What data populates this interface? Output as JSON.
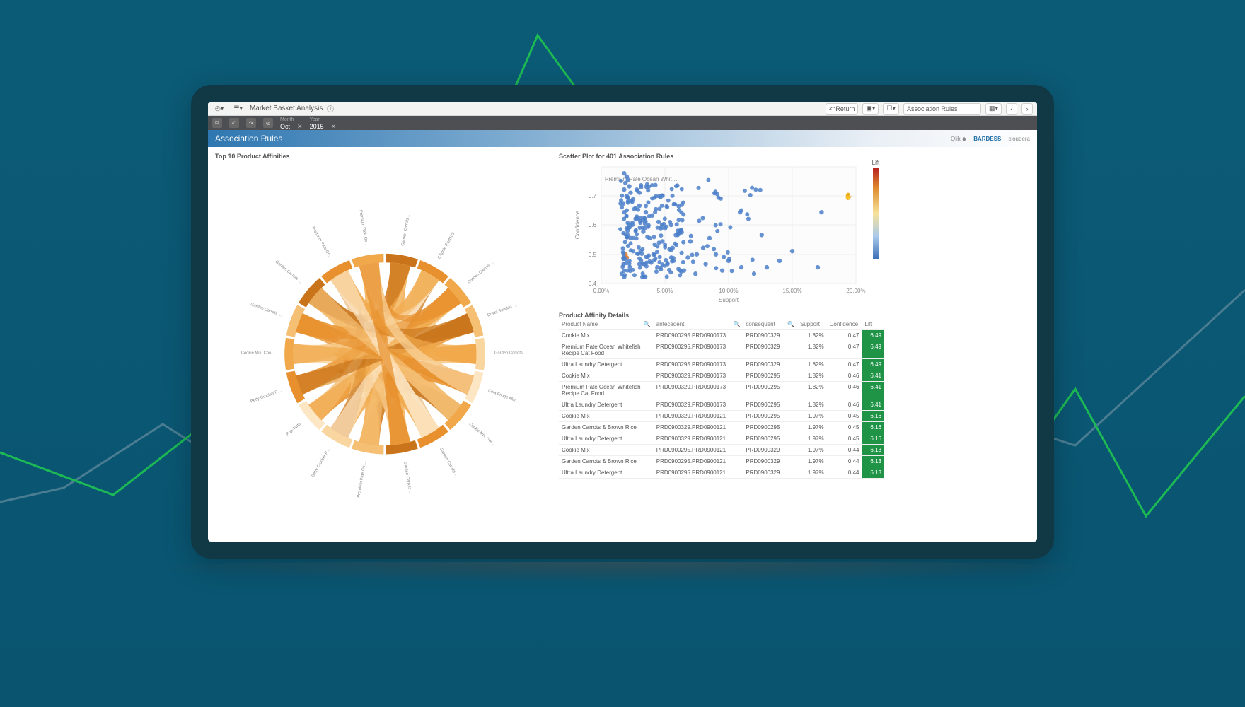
{
  "appbar": {
    "title": "Market Basket Analysis",
    "return": "Return",
    "sheets": "Association Rules"
  },
  "ribbon": {
    "month_label": "Month",
    "month_val": "Oct",
    "year_label": "Year",
    "year_val": "2015"
  },
  "sheet": {
    "title": "Association Rules",
    "brand_qlik": "Qlik",
    "brand_bardess": "BARDESS",
    "brand_cloudera": "cloudera"
  },
  "scatter": {
    "title": "Scatter Plot for 401 Association Rules",
    "xlabel": "Support",
    "ylabel": "Confidence",
    "lift_label": "Lift",
    "annotation": "Premium Pate Ocean Whit…"
  },
  "chord": {
    "title": "Top 10 Product Affinities",
    "labels": [
      "Garden Carrots …",
      "6 Apple Fruit103",
      "Garden Carrots …",
      "Duvet Bonded …",
      "Garden Carrots …",
      "Cola Fridge Mat…",
      "Cookie Mix, Gar…",
      "Garden Carrots …",
      "Garden Carrots …",
      "Premium Pate Oc…",
      "Betty Crocker P…",
      "Pop-Tarts",
      "Betty Crocker P…",
      "Cookie Mix, Coo…",
      "Garden Carrots …",
      "Garden Carrots …",
      "Premium Pate Oc…",
      "Premium Pate Oc…"
    ]
  },
  "table": {
    "title": "Product Affinity Details",
    "cols": [
      "Product Name",
      "antecedent",
      "consequent",
      "Support",
      "Confidence",
      "Lift"
    ],
    "rows": [
      {
        "p": "Cookie Mix",
        "a": "PRD0900295.PRD0900173",
        "c": "PRD0900329",
        "s": "1.82%",
        "con": "0.47",
        "l": "6.49"
      },
      {
        "p": "Premium Pate Ocean Whitefish Recipe Cat Food",
        "a": "PRD0900295.PRD0900173",
        "c": "PRD0900329",
        "s": "1.82%",
        "con": "0.47",
        "l": "6.49"
      },
      {
        "p": "Ultra Laundry Detergent",
        "a": "PRD0900295.PRD0900173",
        "c": "PRD0900329",
        "s": "1.82%",
        "con": "0.47",
        "l": "6.49"
      },
      {
        "p": "Cookie Mix",
        "a": "PRD0900329.PRD0900173",
        "c": "PRD0900295",
        "s": "1.82%",
        "con": "0.46",
        "l": "6.41"
      },
      {
        "p": "Premium Pate Ocean Whitefish Recipe Cat Food",
        "a": "PRD0900329.PRD0900173",
        "c": "PRD0900295",
        "s": "1.82%",
        "con": "0.46",
        "l": "6.41"
      },
      {
        "p": "Ultra Laundry Detergent",
        "a": "PRD0900329.PRD0900173",
        "c": "PRD0900295",
        "s": "1.82%",
        "con": "0.46",
        "l": "6.41"
      },
      {
        "p": "Cookie Mix",
        "a": "PRD0900329.PRD0900121",
        "c": "PRD0900295",
        "s": "1.97%",
        "con": "0.45",
        "l": "6.16"
      },
      {
        "p": "Garden Carrots & Brown Rice",
        "a": "PRD0900329.PRD0900121",
        "c": "PRD0900295",
        "s": "1.97%",
        "con": "0.45",
        "l": "6.16"
      },
      {
        "p": "Ultra Laundry Detergent",
        "a": "PRD0900329.PRD0900121",
        "c": "PRD0900295",
        "s": "1.97%",
        "con": "0.45",
        "l": "6.16"
      },
      {
        "p": "Cookie Mix",
        "a": "PRD0900295.PRD0900121",
        "c": "PRD0900329",
        "s": "1.97%",
        "con": "0.44",
        "l": "6.13"
      },
      {
        "p": "Garden Carrots & Brown Rice",
        "a": "PRD0900295.PRD0900121",
        "c": "PRD0900329",
        "s": "1.97%",
        "con": "0.44",
        "l": "6.13"
      },
      {
        "p": "Ultra Laundry Detergent",
        "a": "PRD0900295.PRD0900121",
        "c": "PRD0900329",
        "s": "1.97%",
        "con": "0.44",
        "l": "6.13"
      }
    ]
  },
  "chart_data": [
    {
      "type": "scatter",
      "title": "Scatter Plot for 401 Association Rules",
      "xlabel": "Support",
      "ylabel": "Confidence",
      "xlim": [
        0,
        0.2
      ],
      "ylim": [
        0.38,
        0.74
      ],
      "xticks": [
        "0.00%",
        "5.00%",
        "10.00%",
        "15.00%",
        "20.00%"
      ],
      "yticks": [
        0.4,
        0.5,
        0.6,
        0.7
      ],
      "color_legend": "Lift",
      "annotation": "Premium Pate Ocean Whit…",
      "series": [
        {
          "name": "rules",
          "points": [
            {
              "x": 0.018,
              "y": 0.72
            },
            {
              "x": 0.02,
              "y": 0.71
            },
            {
              "x": 0.021,
              "y": 0.7
            },
            {
              "x": 0.019,
              "y": 0.69
            },
            {
              "x": 0.022,
              "y": 0.68
            },
            {
              "x": 0.018,
              "y": 0.67
            },
            {
              "x": 0.023,
              "y": 0.66
            },
            {
              "x": 0.02,
              "y": 0.65
            },
            {
              "x": 0.025,
              "y": 0.64
            },
            {
              "x": 0.021,
              "y": 0.63
            },
            {
              "x": 0.03,
              "y": 0.62
            },
            {
              "x": 0.026,
              "y": 0.61
            },
            {
              "x": 0.035,
              "y": 0.6
            },
            {
              "x": 0.018,
              "y": 0.6
            },
            {
              "x": 0.04,
              "y": 0.59
            },
            {
              "x": 0.028,
              "y": 0.58
            },
            {
              "x": 0.045,
              "y": 0.57
            },
            {
              "x": 0.022,
              "y": 0.56
            },
            {
              "x": 0.05,
              "y": 0.55
            },
            {
              "x": 0.033,
              "y": 0.54
            },
            {
              "x": 0.06,
              "y": 0.53
            },
            {
              "x": 0.038,
              "y": 0.52
            },
            {
              "x": 0.07,
              "y": 0.51
            },
            {
              "x": 0.042,
              "y": 0.5
            },
            {
              "x": 0.08,
              "y": 0.49
            },
            {
              "x": 0.025,
              "y": 0.48
            },
            {
              "x": 0.09,
              "y": 0.47
            },
            {
              "x": 0.055,
              "y": 0.46
            },
            {
              "x": 0.1,
              "y": 0.45
            },
            {
              "x": 0.03,
              "y": 0.44
            },
            {
              "x": 0.11,
              "y": 0.43
            },
            {
              "x": 0.065,
              "y": 0.42
            },
            {
              "x": 0.12,
              "y": 0.41
            },
            {
              "x": 0.018,
              "y": 0.4
            },
            {
              "x": 0.13,
              "y": 0.43
            },
            {
              "x": 0.075,
              "y": 0.47
            },
            {
              "x": 0.14,
              "y": 0.45
            },
            {
              "x": 0.085,
              "y": 0.52
            },
            {
              "x": 0.15,
              "y": 0.48
            },
            {
              "x": 0.02,
              "y": 0.55
            },
            {
              "x": 0.17,
              "y": 0.43
            },
            {
              "x": 0.173,
              "y": 0.6
            },
            {
              "x": 0.109,
              "y": 0.6
            },
            {
              "x": 0.126,
              "y": 0.53
            },
            {
              "x": 0.019,
              "y": 0.47,
              "color": "#e0762e"
            },
            {
              "x": 0.02,
              "y": 0.46,
              "color": "#e0762e"
            },
            {
              "x": 0.023,
              "y": 0.52
            },
            {
              "x": 0.027,
              "y": 0.58
            },
            {
              "x": 0.031,
              "y": 0.48
            },
            {
              "x": 0.034,
              "y": 0.44
            },
            {
              "x": 0.037,
              "y": 0.56
            },
            {
              "x": 0.041,
              "y": 0.47
            },
            {
              "x": 0.044,
              "y": 0.43
            },
            {
              "x": 0.048,
              "y": 0.51
            },
            {
              "x": 0.052,
              "y": 0.44
            },
            {
              "x": 0.056,
              "y": 0.49
            },
            {
              "x": 0.062,
              "y": 0.42
            },
            {
              "x": 0.068,
              "y": 0.46
            },
            {
              "x": 0.074,
              "y": 0.41
            },
            {
              "x": 0.082,
              "y": 0.44
            },
            {
              "x": 0.095,
              "y": 0.42
            }
          ]
        }
      ]
    },
    {
      "type": "chord",
      "title": "Top 10 Product Affinities",
      "nodes": [
        "Garden Carrots …",
        "6 Apple Fruit103",
        "Duvet Bonded …",
        "Cola Fridge Mat…",
        "Cookie Mix, Gar…",
        "Premium Pate Oc…",
        "Betty Crocker P…",
        "Pop-Tarts",
        "Cookie Mix, Coo…"
      ],
      "note": "Dense pairwise ribbons among the listed nodes; exact weights not labeled in image."
    }
  ]
}
